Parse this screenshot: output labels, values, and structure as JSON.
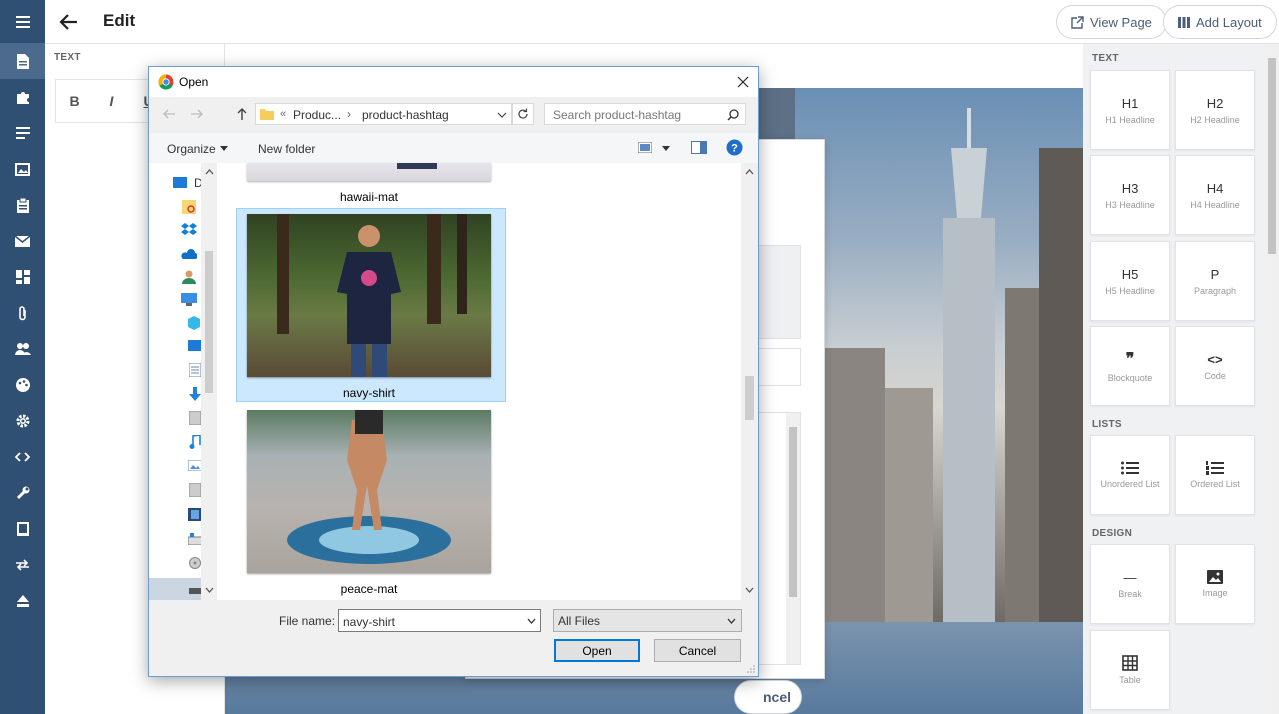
{
  "app": {
    "title": "Edit",
    "view_page": "View Page",
    "add_layout": "Add Layout"
  },
  "sidebar": {
    "icons": [
      "menu-icon",
      "page-icon",
      "puzzle-icon",
      "list-icon",
      "images-icon",
      "clipboard-icon",
      "mail-icon",
      "dashboard-icon",
      "paperclip-icon",
      "users-icon",
      "palette-icon",
      "gear-icon",
      "code-icon",
      "wrench-icon",
      "book-icon",
      "transfer-icon",
      "eject-icon"
    ],
    "active_index": 1
  },
  "left_panel": {
    "section": "TEXT",
    "format_buttons": [
      "B",
      "I",
      "U"
    ]
  },
  "right_panel": {
    "sections": [
      {
        "label": "TEXT",
        "items": [
          {
            "big": "H1",
            "small": "H1 Headline"
          },
          {
            "big": "H2",
            "small": "H2 Headline"
          },
          {
            "big": "H3",
            "small": "H3 Headline"
          },
          {
            "big": "H4",
            "small": "H4 Headline"
          },
          {
            "big": "H5",
            "small": "H5 Headline"
          },
          {
            "big": "P",
            "small": "Paragraph"
          },
          {
            "big": "❞",
            "small": "Blockquote"
          },
          {
            "big": "<>",
            "small": "Code"
          }
        ]
      },
      {
        "label": "LISTS",
        "items": [
          {
            "big": "",
            "small": "Unordered List"
          },
          {
            "big": "",
            "small": "Ordered List"
          }
        ]
      },
      {
        "label": "DESIGN",
        "items": [
          {
            "big": "—",
            "small": "Break"
          },
          {
            "big": "",
            "small": "Image"
          },
          {
            "big": "",
            "small": "Table"
          }
        ]
      }
    ]
  },
  "under_panel": {
    "cancel_partial": "ncel"
  },
  "dialog": {
    "title": "Open",
    "breadcrumb": [
      "«",
      "Produc...",
      "product-hashtag"
    ],
    "search_placeholder": "Search product-hashtag",
    "organize": "Organize",
    "new_folder": "New folder",
    "nav_first": "D",
    "files": [
      {
        "name": "hawaii-mat",
        "selected": false
      },
      {
        "name": "navy-shirt",
        "selected": true
      },
      {
        "name": "peace-mat",
        "selected": false
      }
    ],
    "file_name_label": "File name:",
    "file_name_value": "navy-shirt",
    "filter": "All Files",
    "open": "Open",
    "cancel": "Cancel"
  }
}
